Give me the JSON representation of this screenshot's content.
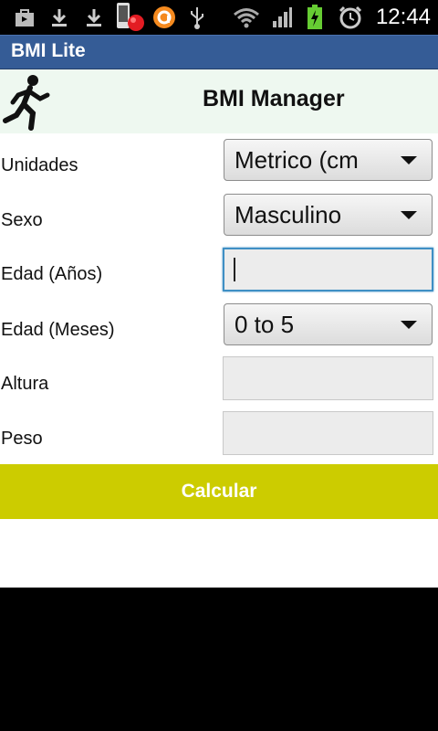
{
  "status_bar": {
    "time": "12:44",
    "icons": [
      "bag-icon",
      "download-icon",
      "download-icon",
      "phone-icon",
      "notification-icon",
      "usb-icon",
      "wifi-icon",
      "signal-icon",
      "battery-icon",
      "alarm-icon"
    ]
  },
  "title_bar": {
    "title": "BMI Lite"
  },
  "banner": {
    "heading": "BMI Manager",
    "logo": "runner-icon"
  },
  "form": {
    "units": {
      "label": "Unidades",
      "value": "Metrico (cm"
    },
    "sex": {
      "label": "Sexo",
      "value": "Masculino"
    },
    "age_years": {
      "label": "Edad (Años)",
      "value": ""
    },
    "age_months": {
      "label": "Edad (Meses)",
      "value": "0 to 5"
    },
    "height": {
      "label": "Altura",
      "value": ""
    },
    "weight": {
      "label": "Peso",
      "value": ""
    }
  },
  "calculate_button": {
    "label": "Calcular"
  },
  "colors": {
    "title_bar": "#355c96",
    "button": "#cccc00",
    "banner": "#eef8f0",
    "focus": "#3f8fc4"
  }
}
